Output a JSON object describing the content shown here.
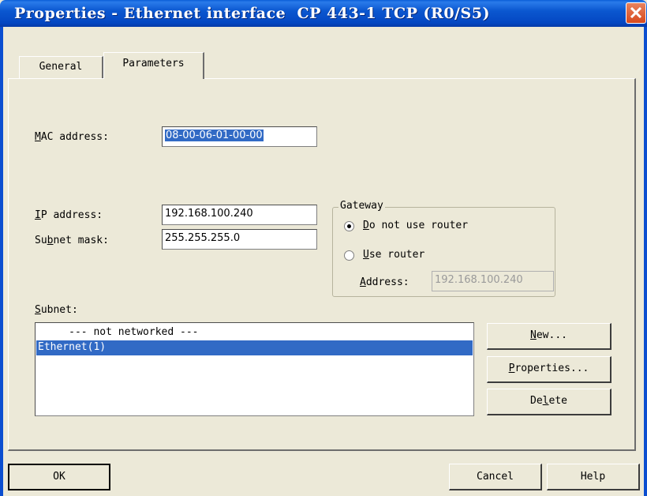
{
  "window": {
    "title": "Properties - Ethernet interface  CP 443-1 TCP (R0/S5)"
  },
  "tabs": [
    {
      "label": "General"
    },
    {
      "label": "Parameters"
    }
  ],
  "mac": {
    "label_ul": "M",
    "label_rest": "AC address:",
    "value": "08-00-06-01-00-00"
  },
  "ip": {
    "label_ul": "I",
    "label_rest": "P address:",
    "value": "192.168.100.240"
  },
  "subnet_mask": {
    "label_pre": "Su",
    "label_ul": "b",
    "label_rest": "net mask:",
    "value": "255.255.255.0"
  },
  "gateway": {
    "title": "Gateway",
    "no_router": {
      "label_ul": "D",
      "label_rest": "o not use router",
      "selected": true
    },
    "use_router": {
      "label_ul": "U",
      "label_rest": "se router",
      "selected": false
    },
    "address_ul": "A",
    "address_rest": "ddress:",
    "address_value": "192.168.100.240"
  },
  "subnet": {
    "label_ul": "S",
    "label_rest": "ubnet:",
    "items": [
      "     --- not networked ---",
      "Ethernet(1)"
    ],
    "selected_index": 1
  },
  "buttons": {
    "new_ul": "N",
    "new_rest": "ew...",
    "properties_ul": "P",
    "properties_rest": "roperties...",
    "delete_pre": "De",
    "delete_ul": "l",
    "delete_rest": "ete",
    "ok": "OK",
    "cancel": "Cancel",
    "help": "Help"
  },
  "colors": {
    "titlebar": "#0b57d0",
    "selection": "#316ac5",
    "dialog_bg": "#ece9d8",
    "close_button": "#d8491c"
  }
}
